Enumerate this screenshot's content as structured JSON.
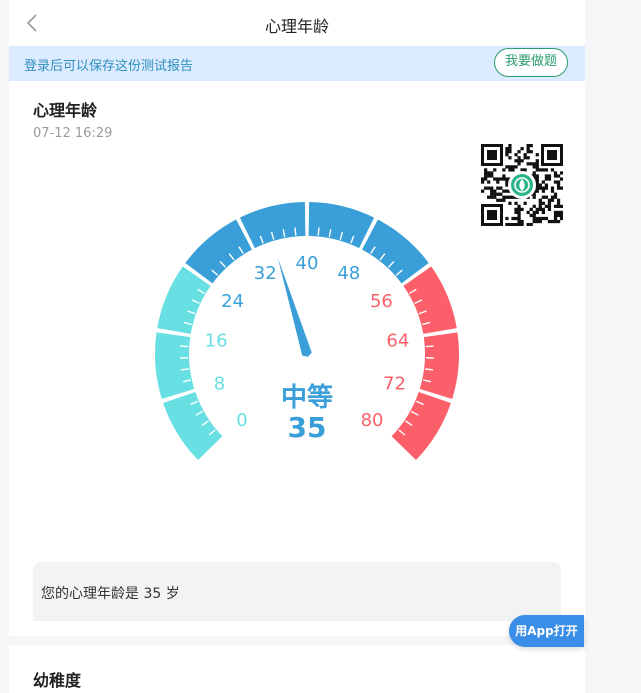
{
  "nav": {
    "title": "心理年龄"
  },
  "login_bar": {
    "text": "登录后可以保存这份测试报告",
    "button": "我要做题"
  },
  "report": {
    "title": "心理年龄",
    "time": "07-12 16:29"
  },
  "gauge": {
    "value": 35,
    "min": 0,
    "max": 80,
    "level": "中等",
    "ticks": [
      "0",
      "8",
      "16",
      "24",
      "32",
      "40",
      "48",
      "56",
      "64",
      "72",
      "80"
    ],
    "colors": {
      "low": "#67dfe3",
      "mid": "#3a9fd8",
      "high": "#fb5f69"
    }
  },
  "result": {
    "text": "您的心理年龄是 35 岁"
  },
  "next_section": {
    "title": "幼稚度"
  },
  "app_button": {
    "label": "用App打开"
  }
}
